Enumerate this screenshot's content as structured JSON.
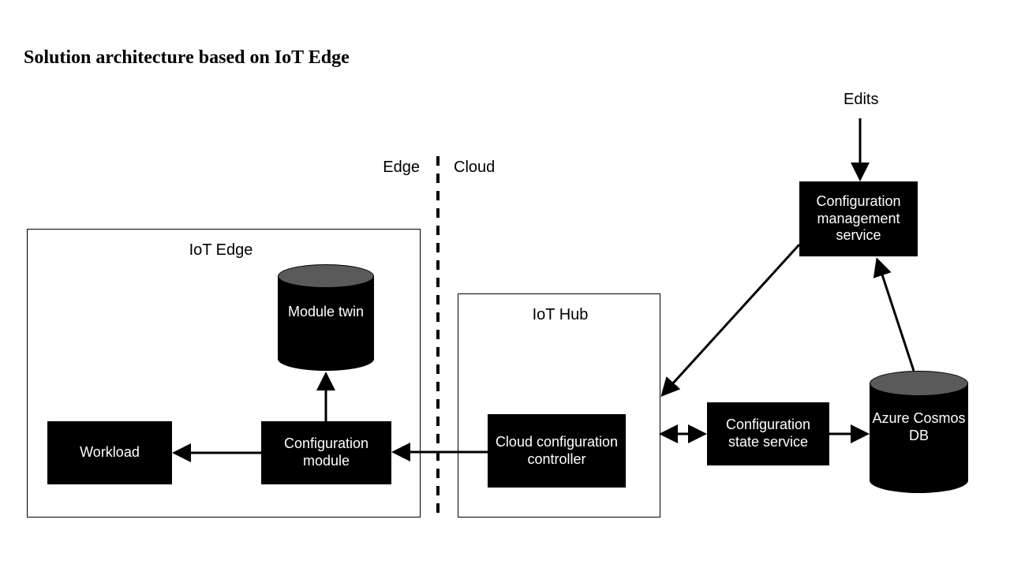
{
  "title": "Solution architecture based on IoT Edge",
  "regions": {
    "edge": "Edge",
    "cloud": "Cloud"
  },
  "groups": {
    "iot_edge": "IoT Edge",
    "iot_hub": "IoT Hub"
  },
  "nodes": {
    "workload": "Workload",
    "config_module": "Configuration module",
    "module_twin": "Module twin",
    "cloud_config_controller": "Cloud configuration controller",
    "config_state_service": "Configuration state service",
    "config_mgmt_service": "Configuration management service",
    "cosmos_db": "Azure Cosmos DB",
    "edits": "Edits"
  },
  "diagram": {
    "type": "architecture",
    "description": "Edge/cloud split with dashed divider. IoT Edge group contains Workload, Configuration module, and Module twin (cylinder). IoT Hub group contains Cloud configuration controller. To the right: Configuration state service, Azure Cosmos DB (cylinder), Configuration management service. External 'Edits' label feeds into Configuration management service.",
    "edges": [
      {
        "from": "config_module",
        "to": "workload",
        "style": "arrow"
      },
      {
        "from": "config_module",
        "to": "module_twin",
        "style": "arrow"
      },
      {
        "from": "cloud_config_controller",
        "to": "config_module",
        "style": "arrow"
      },
      {
        "from": "iot_hub",
        "to": "config_state_service",
        "style": "bidirectional"
      },
      {
        "from": "config_state_service",
        "to": "cosmos_db",
        "style": "arrow"
      },
      {
        "from": "cosmos_db",
        "to": "config_mgmt_service",
        "style": "arrow"
      },
      {
        "from": "config_mgmt_service",
        "to": "iot_hub",
        "style": "arrow"
      },
      {
        "from": "edits",
        "to": "config_mgmt_service",
        "style": "arrow"
      }
    ]
  }
}
